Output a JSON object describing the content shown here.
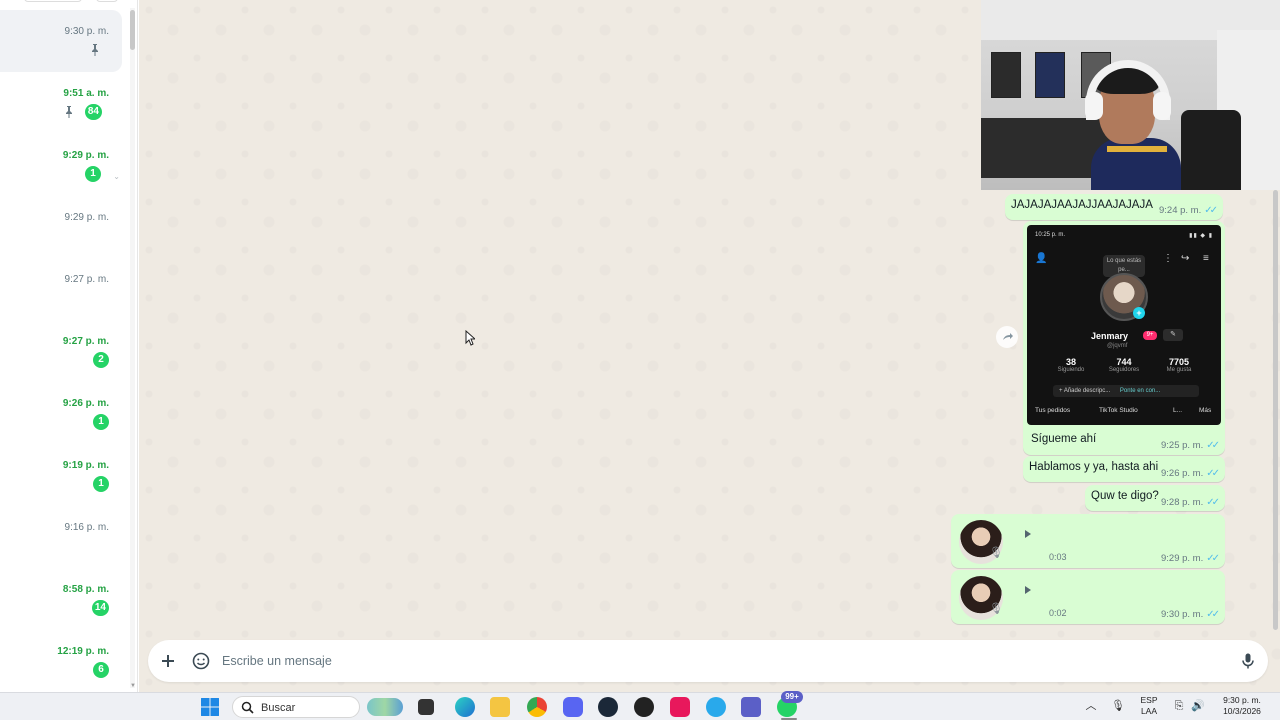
{
  "chat_list": {
    "rows": [
      {
        "time": "9:30 p. m.",
        "unread": false,
        "pinned": true
      },
      {
        "time": "9:51 a. m.",
        "unread": true,
        "pinned": true,
        "badge": "84"
      },
      {
        "time": "9:29 p. m.",
        "unread": true,
        "badge": "1"
      },
      {
        "time": "9:29 p. m.",
        "unread": false
      },
      {
        "time": "9:27 p. m.",
        "unread": false
      },
      {
        "time": "9:27 p. m.",
        "unread": true,
        "badge": "2"
      },
      {
        "time": "9:26 p. m.",
        "unread": true,
        "badge": "1"
      },
      {
        "time": "9:19 p. m.",
        "unread": true,
        "badge": "1"
      },
      {
        "time": "9:16 p. m.",
        "unread": false
      },
      {
        "time": "8:58 p. m.",
        "unread": true,
        "badge": "14"
      },
      {
        "time": "12:19 p. m.",
        "unread": true,
        "badge": "6"
      }
    ]
  },
  "conversation": {
    "messages": {
      "m1": {
        "text": "JAJAJAJAAJAJJAAJAJAJA",
        "time": "9:24 p. m."
      },
      "image": {
        "time": "9:25 p. m.",
        "caption": "Sígueme ahí",
        "screenshot": {
          "status_time": "10:25 p. m.",
          "bubble_text": "Lo que estás pe...",
          "name": "Jenmary",
          "handle": "@jqvmf",
          "badge": "9+",
          "stats": [
            {
              "num": "38",
              "label": "Siguiendo"
            },
            {
              "num": "744",
              "label": "Seguidores"
            },
            {
              "num": "7705",
              "label": "Me gusta"
            }
          ],
          "desc_left": "+ Añade descripc...",
          "desc_right": "Ponte en con...",
          "bottom": [
            "Tus pedidos",
            "TikTok Studio",
            "L...",
            "Más"
          ]
        }
      },
      "m2": {
        "text": "Hablamos y ya, hasta ahi",
        "time": "9:26 p. m."
      },
      "m3": {
        "text": "Quw te digo?",
        "time": "9:28 p. m."
      },
      "voice1": {
        "duration": "0:03",
        "time": "9:29 p. m."
      },
      "voice2": {
        "duration": "0:02",
        "time": "9:30 p. m."
      }
    },
    "status_ticks": "✓✓"
  },
  "compose": {
    "placeholder": "Escribe un mensaje"
  },
  "taskbar": {
    "search_label": "Buscar",
    "notification_badge": "99+",
    "language_top": "ESP",
    "language_bottom": "LAA",
    "clock_time": "9:30 p. m.",
    "clock_date": "10/3/2026"
  },
  "colors": {
    "accent": "#25d366",
    "bubble_out": "#d9fdd3",
    "chat_bg": "#efeae2",
    "read_ticks": "#53bdeb"
  }
}
